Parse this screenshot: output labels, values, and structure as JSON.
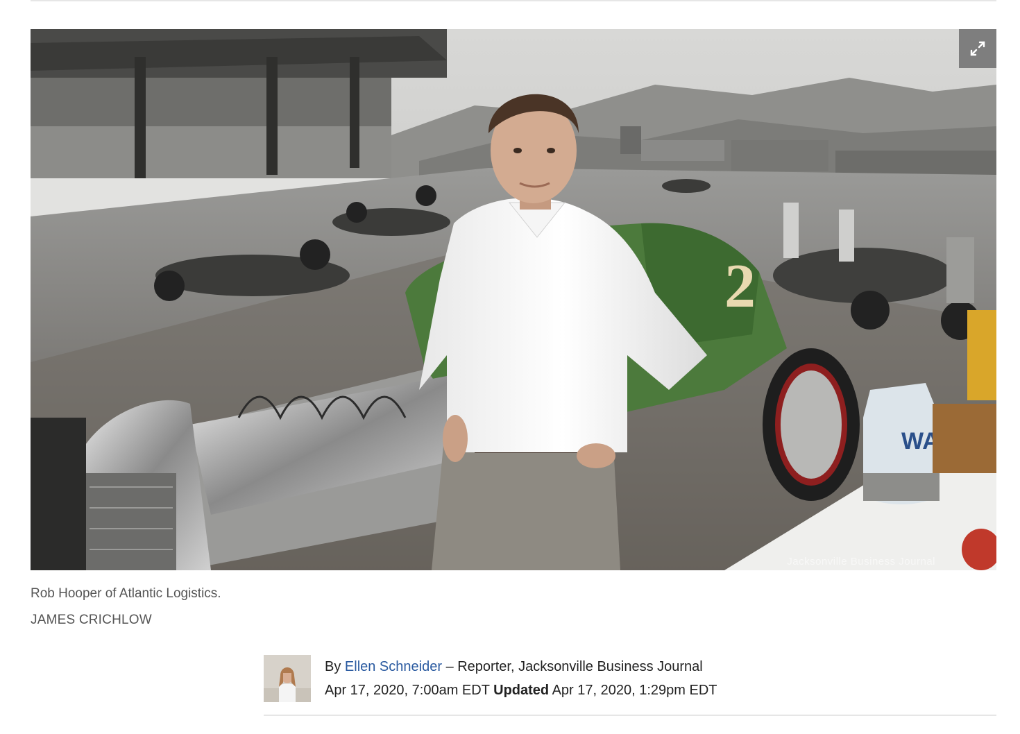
{
  "photo": {
    "alt": "Rob Hooper of Atlantic Logistics.",
    "watermark": "Jacksonville Business Journal",
    "expand_icon": "expand-arrows-icon"
  },
  "caption": {
    "text": "Rob Hooper of Atlantic Logistics.",
    "credit": "JAMES CRICHLOW"
  },
  "byline": {
    "prefix": "By",
    "author": "Ellen Schneider",
    "role": "– Reporter, Jacksonville Business Journal",
    "published": "Apr 17, 2020, 7:00am EDT",
    "updated_label": "Updated",
    "updated": "Apr 17, 2020, 1:29pm EDT"
  }
}
